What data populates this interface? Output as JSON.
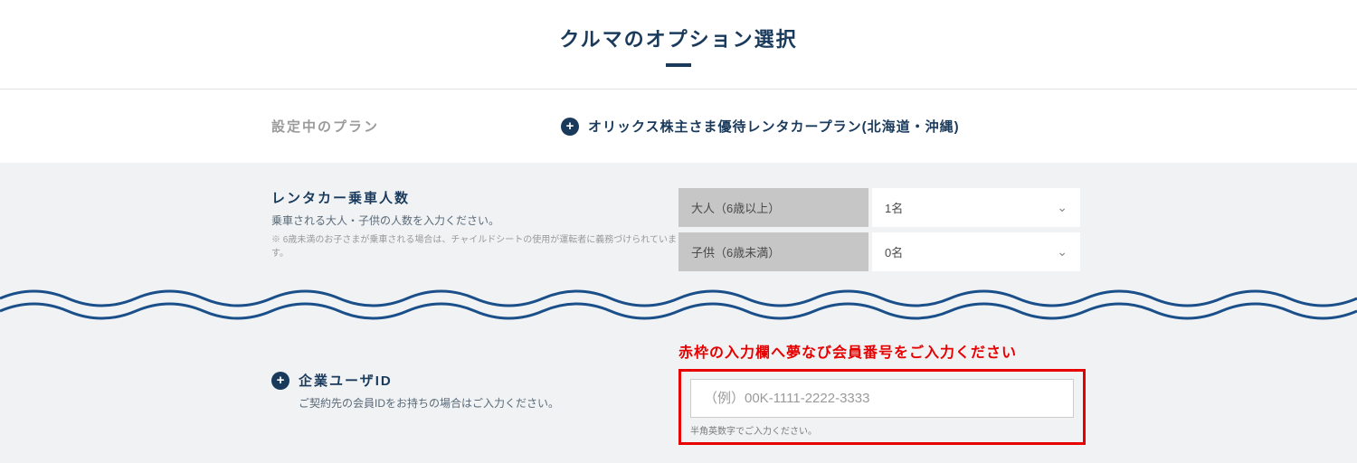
{
  "title": "クルマのオプション選択",
  "plan": {
    "label": "設定中のプラン",
    "name": "オリックス株主さま優待レンタカープラン(北海道・沖縄)"
  },
  "passengers": {
    "heading": "レンタカー乗車人数",
    "desc": "乗車される大人・子供の人数を入力ください。",
    "note": "※ 6歳未満のお子さまが乗車される場合は、チャイルドシートの使用が運転者に義務づけられています。",
    "rows": [
      {
        "label": "大人（6歳以上）",
        "value": "1名"
      },
      {
        "label": "子供（6歳未満）",
        "value": "0名"
      }
    ]
  },
  "corpId": {
    "heading": "企業ユーザID",
    "desc": "ご契約先の会員IDをお持ちの場合はご入力ください。",
    "instruction": "赤枠の入力欄へ夢なび会員番号をご入力ください",
    "placeholder": "（例）00K-1111-2222-3333",
    "help": "半角英数字でご入力ください。"
  }
}
